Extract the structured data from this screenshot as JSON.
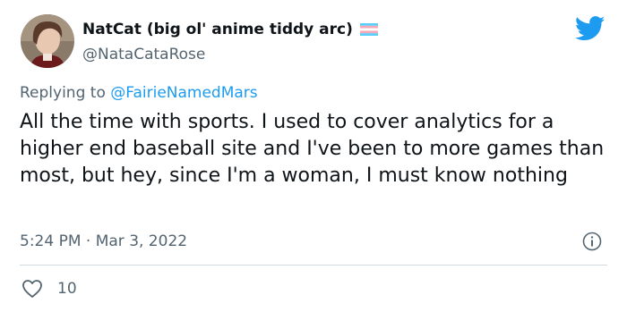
{
  "author": {
    "display_name": "NatCat (big ol' anime tiddy arc)",
    "handle": "@NataCataRose",
    "flag_icon": "transgender-flag-icon",
    "flag_colors": [
      "#5bcefa",
      "#f5a9b8",
      "#ffffff",
      "#f5a9b8",
      "#5bcefa"
    ]
  },
  "reply": {
    "prefix": "Replying to ",
    "mention": "@FairieNamedMars"
  },
  "tweet": {
    "text": "All the time with sports. I used to cover analytics for a higher end baseball site and I've been to more games than most, but hey, since I'm a woman, I must know nothing",
    "timestamp": "5:24 PM · Mar 3, 2022"
  },
  "actions": {
    "like_count": "10",
    "like_icon": "heart-icon",
    "info_icon": "info-icon"
  },
  "brand": {
    "icon": "twitter-bird-icon",
    "color": "#1d9bf0"
  }
}
